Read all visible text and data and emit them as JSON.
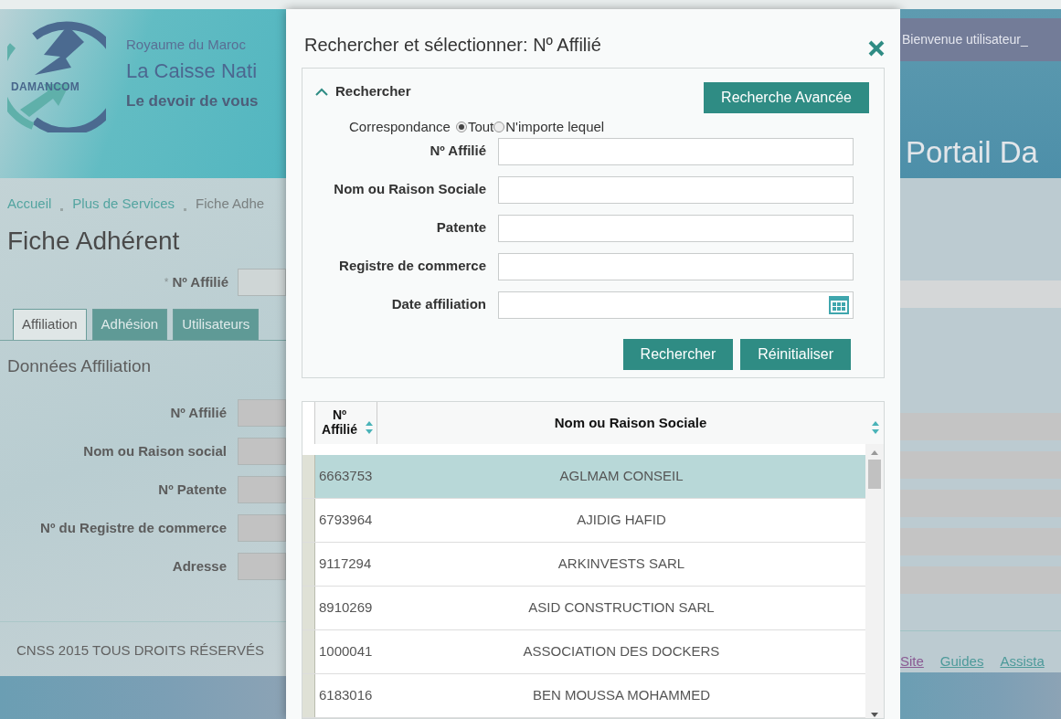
{
  "header": {
    "logo_text": "DAMANCOM",
    "kingdom": "Royaume du Maroc",
    "org": "La Caisse Nati",
    "motto": "Le devoir de vous",
    "welcome": "Bienvenue utilisateur_",
    "portal": "Portail Da"
  },
  "breadcrumb": [
    "Accueil",
    "Plus de Services",
    "Fiche Adhe"
  ],
  "page_title": "Fiche Adhérent",
  "affilie_field": {
    "marker": "*",
    "label": "Nº Affilié"
  },
  "tabs": [
    {
      "label": "Affiliation",
      "selected": true
    },
    {
      "label": "Adhésion",
      "selected": false
    },
    {
      "label": "Utilisateurs",
      "selected": false
    }
  ],
  "section_title": "Données Affiliation",
  "affiliation_fields": [
    "Nº Affilié",
    "Nom ou Raison social",
    "Nº Patente",
    "Nº du Registre de commerce",
    "Adresse"
  ],
  "footer": {
    "copyright": "CNSS 2015 TOUS DROITS RÉSERVÉS",
    "links": [
      "Site",
      "Guides",
      "Assista"
    ]
  },
  "dialog": {
    "title": "Rechercher et sélectionner: Nº Affilié",
    "search_panel": {
      "title": "Rechercher",
      "expanded": true,
      "advanced_button": "Recherche Avancée",
      "match_label": "Correspondance",
      "match_options": [
        {
          "label": "Tout",
          "selected": true
        },
        {
          "label": "N'importe lequel",
          "selected": false
        }
      ],
      "fields": [
        {
          "label": "Nº Affilié",
          "kind": "text"
        },
        {
          "label": "Nom ou Raison Sociale",
          "kind": "text"
        },
        {
          "label": "Patente",
          "kind": "text"
        },
        {
          "label": "Registre de commerce",
          "kind": "text"
        },
        {
          "label": "Date affiliation",
          "kind": "date"
        }
      ],
      "buttons": [
        "Rechercher",
        "Réinitialiser"
      ]
    },
    "results": {
      "columns": [
        "Nº Affilié",
        "Nom ou Raison Sociale"
      ],
      "rows": [
        {
          "affilie": "6663753",
          "name": "AGLMAM CONSEIL",
          "selected": true
        },
        {
          "affilie": "6793964",
          "name": "AJIDIG HAFID",
          "selected": false
        },
        {
          "affilie": "9117294",
          "name": "ARKINVESTS SARL",
          "selected": false
        },
        {
          "affilie": "8910269",
          "name": "ASID CONSTRUCTION SARL",
          "selected": false
        },
        {
          "affilie": "1000041",
          "name": "ASSOCIATION DES DOCKERS",
          "selected": false
        },
        {
          "affilie": "6183016",
          "name": "BEN MOUSSA MOHAMMED",
          "selected": false
        }
      ]
    }
  }
}
